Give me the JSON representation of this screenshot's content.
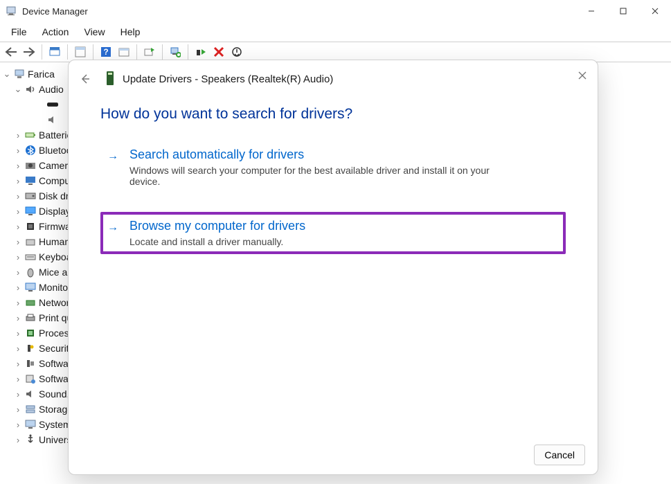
{
  "window": {
    "title": "Device Manager"
  },
  "winctl": {
    "min": "—",
    "max": "▢",
    "close": "✕"
  },
  "menu": {
    "items": [
      "File",
      "Action",
      "View",
      "Help"
    ]
  },
  "tree": {
    "root": "Farica",
    "audio": "Audio",
    "items": [
      "Batteries",
      "Bluetooth",
      "Cameras",
      "Computer",
      "Disk drives",
      "Display adapters",
      "Firmware",
      "Human Interface Devices",
      "Keyboards",
      "Mice and other pointing devices",
      "Monitors",
      "Network adapters",
      "Print queues",
      "Processors",
      "Security devices",
      "Software components",
      "Software devices",
      "Sound, video and game controllers",
      "Storage controllers",
      "System devices",
      "Universal Serial Bus controllers"
    ]
  },
  "dialog": {
    "title": "Update Drivers - Speakers (Realtek(R) Audio)",
    "question": "How do you want to search for drivers?",
    "opt1": {
      "title": "Search automatically for drivers",
      "desc": "Windows will search your computer for the best available driver and install it on your device."
    },
    "opt2": {
      "title": "Browse my computer for drivers",
      "desc": "Locate and install a driver manually."
    },
    "cancel": "Cancel"
  }
}
